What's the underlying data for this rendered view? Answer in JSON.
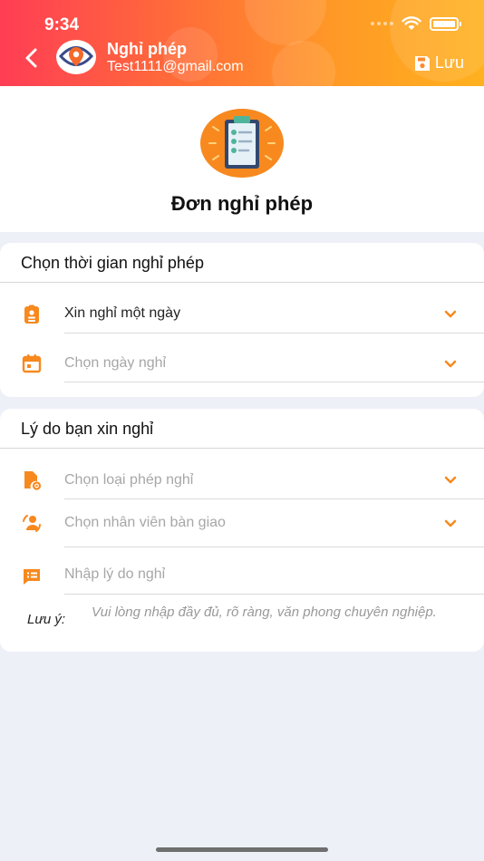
{
  "status_bar": {
    "time": "9:34"
  },
  "header": {
    "title": "Nghỉ phép",
    "subtitle": "Test1111@gmail.com",
    "save_label": "Lưu"
  },
  "form": {
    "title": "Đơn nghỉ phép"
  },
  "section_time": {
    "title": "Chọn thời gian nghỉ phép",
    "leave_type_value": "Xin nghỉ một ngày",
    "date_placeholder": "Chọn ngày nghỉ"
  },
  "section_reason": {
    "title": "Lý do bạn xin nghỉ",
    "leave_category_placeholder": "Chọn loại phép nghỉ",
    "handover_placeholder": "Chọn nhân viên bàn giao",
    "reason_placeholder": "Nhập lý do nghỉ",
    "note_label": "Lưu ý:",
    "note_text": "Vui lòng nhập đầy đủ, rõ ràng, văn phong chuyên nghiệp."
  },
  "colors": {
    "accent": "#f7891f",
    "header_start": "#ff3d55",
    "header_end": "#ffb11f"
  }
}
